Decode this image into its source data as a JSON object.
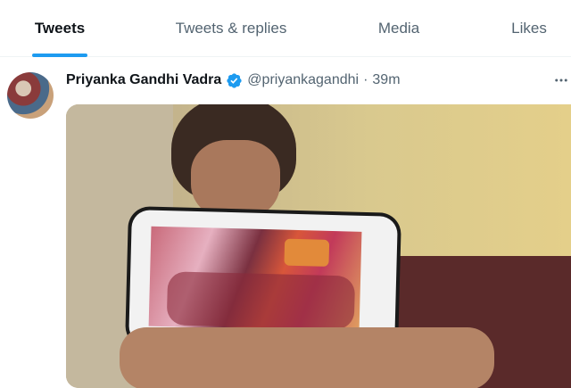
{
  "tabs": [
    {
      "label": "Tweets",
      "active": true
    },
    {
      "label": "Tweets & replies",
      "active": false
    },
    {
      "label": "Media",
      "active": false
    },
    {
      "label": "Likes",
      "active": false
    }
  ],
  "tweet": {
    "author_name": "Priyanka Gandhi Vadra",
    "handle": "@priyankagandhi",
    "separator": "·",
    "time": "39m",
    "verified_icon": "verified-badge-icon",
    "more_icon": "more-options-icon"
  },
  "colors": {
    "accent": "#1d9bf0",
    "text_primary": "#0f1419",
    "text_secondary": "#536471"
  }
}
